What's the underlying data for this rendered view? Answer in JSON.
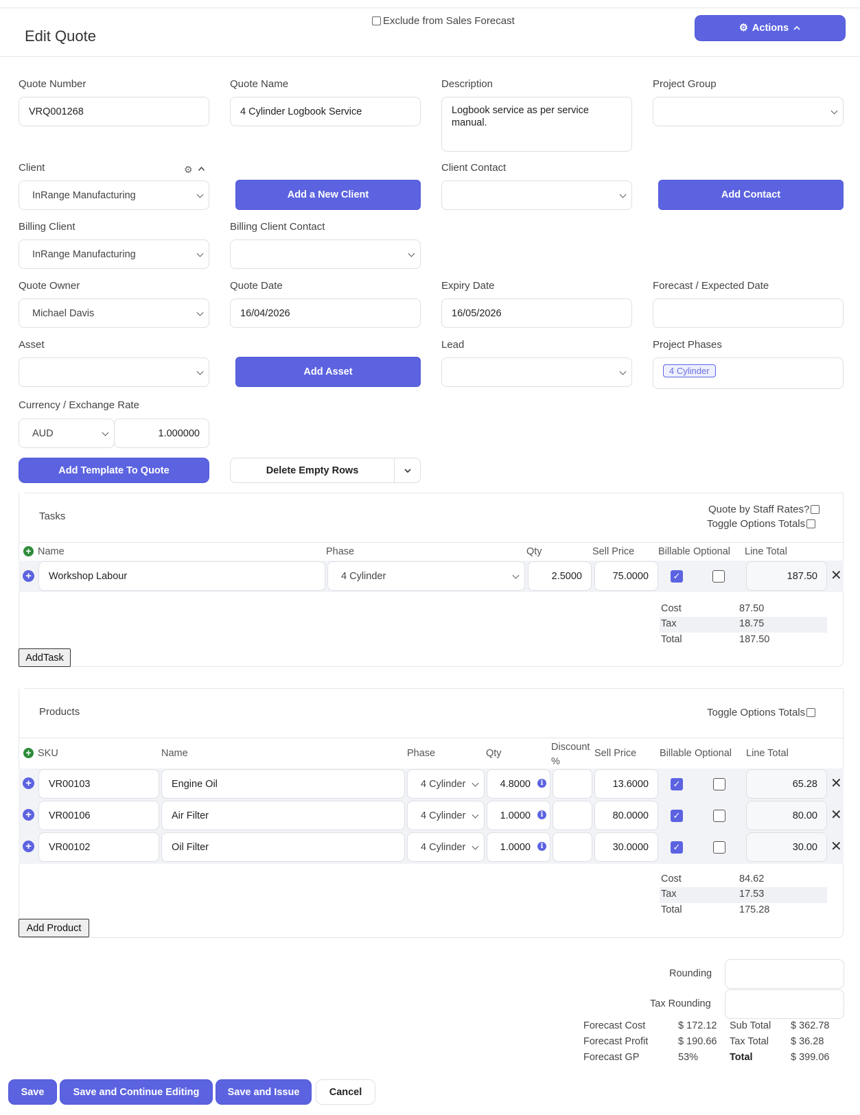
{
  "header": {
    "title": "Edit Quote",
    "exclude_label": "Exclude from Sales Forecast",
    "actions_label": "Actions"
  },
  "form": {
    "quote_number": {
      "label": "Quote Number",
      "value": "VRQ001268"
    },
    "quote_name": {
      "label": "Quote Name",
      "value": "4 Cylinder Logbook Service"
    },
    "description": {
      "label": "Description",
      "value": "Logbook service as per service manual."
    },
    "project_group": {
      "label": "Project Group",
      "value": ""
    },
    "client": {
      "label": "Client",
      "value": "InRange Manufacturing"
    },
    "add_client_label": "Add a New Client",
    "client_contact": {
      "label": "Client Contact",
      "value": ""
    },
    "add_contact_label": "Add Contact",
    "billing_client": {
      "label": "Billing Client",
      "value": "InRange Manufacturing"
    },
    "billing_client_contact": {
      "label": "Billing Client Contact",
      "value": ""
    },
    "quote_owner": {
      "label": "Quote Owner",
      "value": "Michael Davis"
    },
    "quote_date": {
      "label": "Quote Date",
      "value": "16/04/2026"
    },
    "expiry_date": {
      "label": "Expiry Date",
      "value": "16/05/2026"
    },
    "forecast_date": {
      "label": "Forecast / Expected Date",
      "value": ""
    },
    "asset": {
      "label": "Asset",
      "value": ""
    },
    "add_asset_label": "Add Asset",
    "lead": {
      "label": "Lead",
      "value": ""
    },
    "project_phases": {
      "label": "Project Phases",
      "tag": "4 Cylinder"
    },
    "currency": {
      "label": "Currency / Exchange Rate",
      "value": "AUD",
      "rate": "1.000000"
    },
    "add_template_label": "Add Template To Quote",
    "delete_empty_label": "Delete Empty Rows"
  },
  "tasks": {
    "title": "Tasks",
    "staff_rates_label": "Quote by Staff Rates?",
    "toggle_totals_label": "Toggle Options Totals",
    "headers": {
      "name": "Name",
      "phase": "Phase",
      "qty": "Qty",
      "sell_price": "Sell Price",
      "billable": "Billable",
      "optional": "Optional",
      "line_total": "Line Total"
    },
    "rows": [
      {
        "name": "Workshop Labour",
        "phase": "4 Cylinder",
        "qty": "2.5000",
        "sell_price": "75.0000",
        "line_total": "187.50"
      }
    ],
    "summary": {
      "cost_label": "Cost",
      "cost": "87.50",
      "tax_label": "Tax",
      "tax": "18.75",
      "total_label": "Total",
      "total": "187.50"
    },
    "add_label": "AddTask"
  },
  "products": {
    "title": "Products",
    "toggle_totals_label": "Toggle Options Totals",
    "headers": {
      "sku": "SKU",
      "name": "Name",
      "phase": "Phase",
      "qty": "Qty",
      "discount": "Discount %",
      "sell_price": "Sell Price",
      "billable": "Billable",
      "optional": "Optional",
      "line_total": "Line Total"
    },
    "rows": [
      {
        "sku": "VR00103",
        "name": "Engine Oil",
        "phase": "4 Cylinder",
        "qty": "4.8000",
        "sell_price": "13.6000",
        "line_total": "65.28"
      },
      {
        "sku": "VR00106",
        "name": "Air Filter",
        "phase": "4 Cylinder",
        "qty": "1.0000",
        "sell_price": "80.0000",
        "line_total": "80.00"
      },
      {
        "sku": "VR00102",
        "name": "Oil Filter",
        "phase": "4 Cylinder",
        "qty": "1.0000",
        "sell_price": "30.0000",
        "line_total": "30.00"
      }
    ],
    "summary": {
      "cost_label": "Cost",
      "cost": "84.62",
      "tax_label": "Tax",
      "tax": "17.53",
      "total_label": "Total",
      "total": "175.28"
    },
    "add_label": "Add Product"
  },
  "totals": {
    "rounding_label": "Rounding",
    "tax_rounding_label": "Tax Rounding",
    "forecast_cost_label": "Forecast Cost",
    "forecast_cost": "$ 172.12",
    "forecast_profit_label": "Forecast Profit",
    "forecast_profit": "$ 190.66",
    "forecast_gp_label": "Forecast GP",
    "forecast_gp": "53%",
    "sub_total_label": "Sub Total",
    "sub_total": "$ 362.78",
    "tax_total_label": "Tax Total",
    "tax_total": "$ 36.28",
    "total_label": "Total",
    "total": "$ 399.06"
  },
  "footer": {
    "save_label": "Save",
    "save_continue_label": "Save and Continue Editing",
    "save_issue_label": "Save and Issue",
    "cancel_label": "Cancel"
  },
  "colors": {
    "primary": "#5c63e0",
    "success": "#2e8b3a",
    "border": "#dcdfe4"
  },
  "icons": [
    "gear-icon",
    "chevron-up-icon",
    "chevron-down-icon",
    "plus-icon",
    "close-icon",
    "info-icon",
    "checkbox-icon"
  ]
}
